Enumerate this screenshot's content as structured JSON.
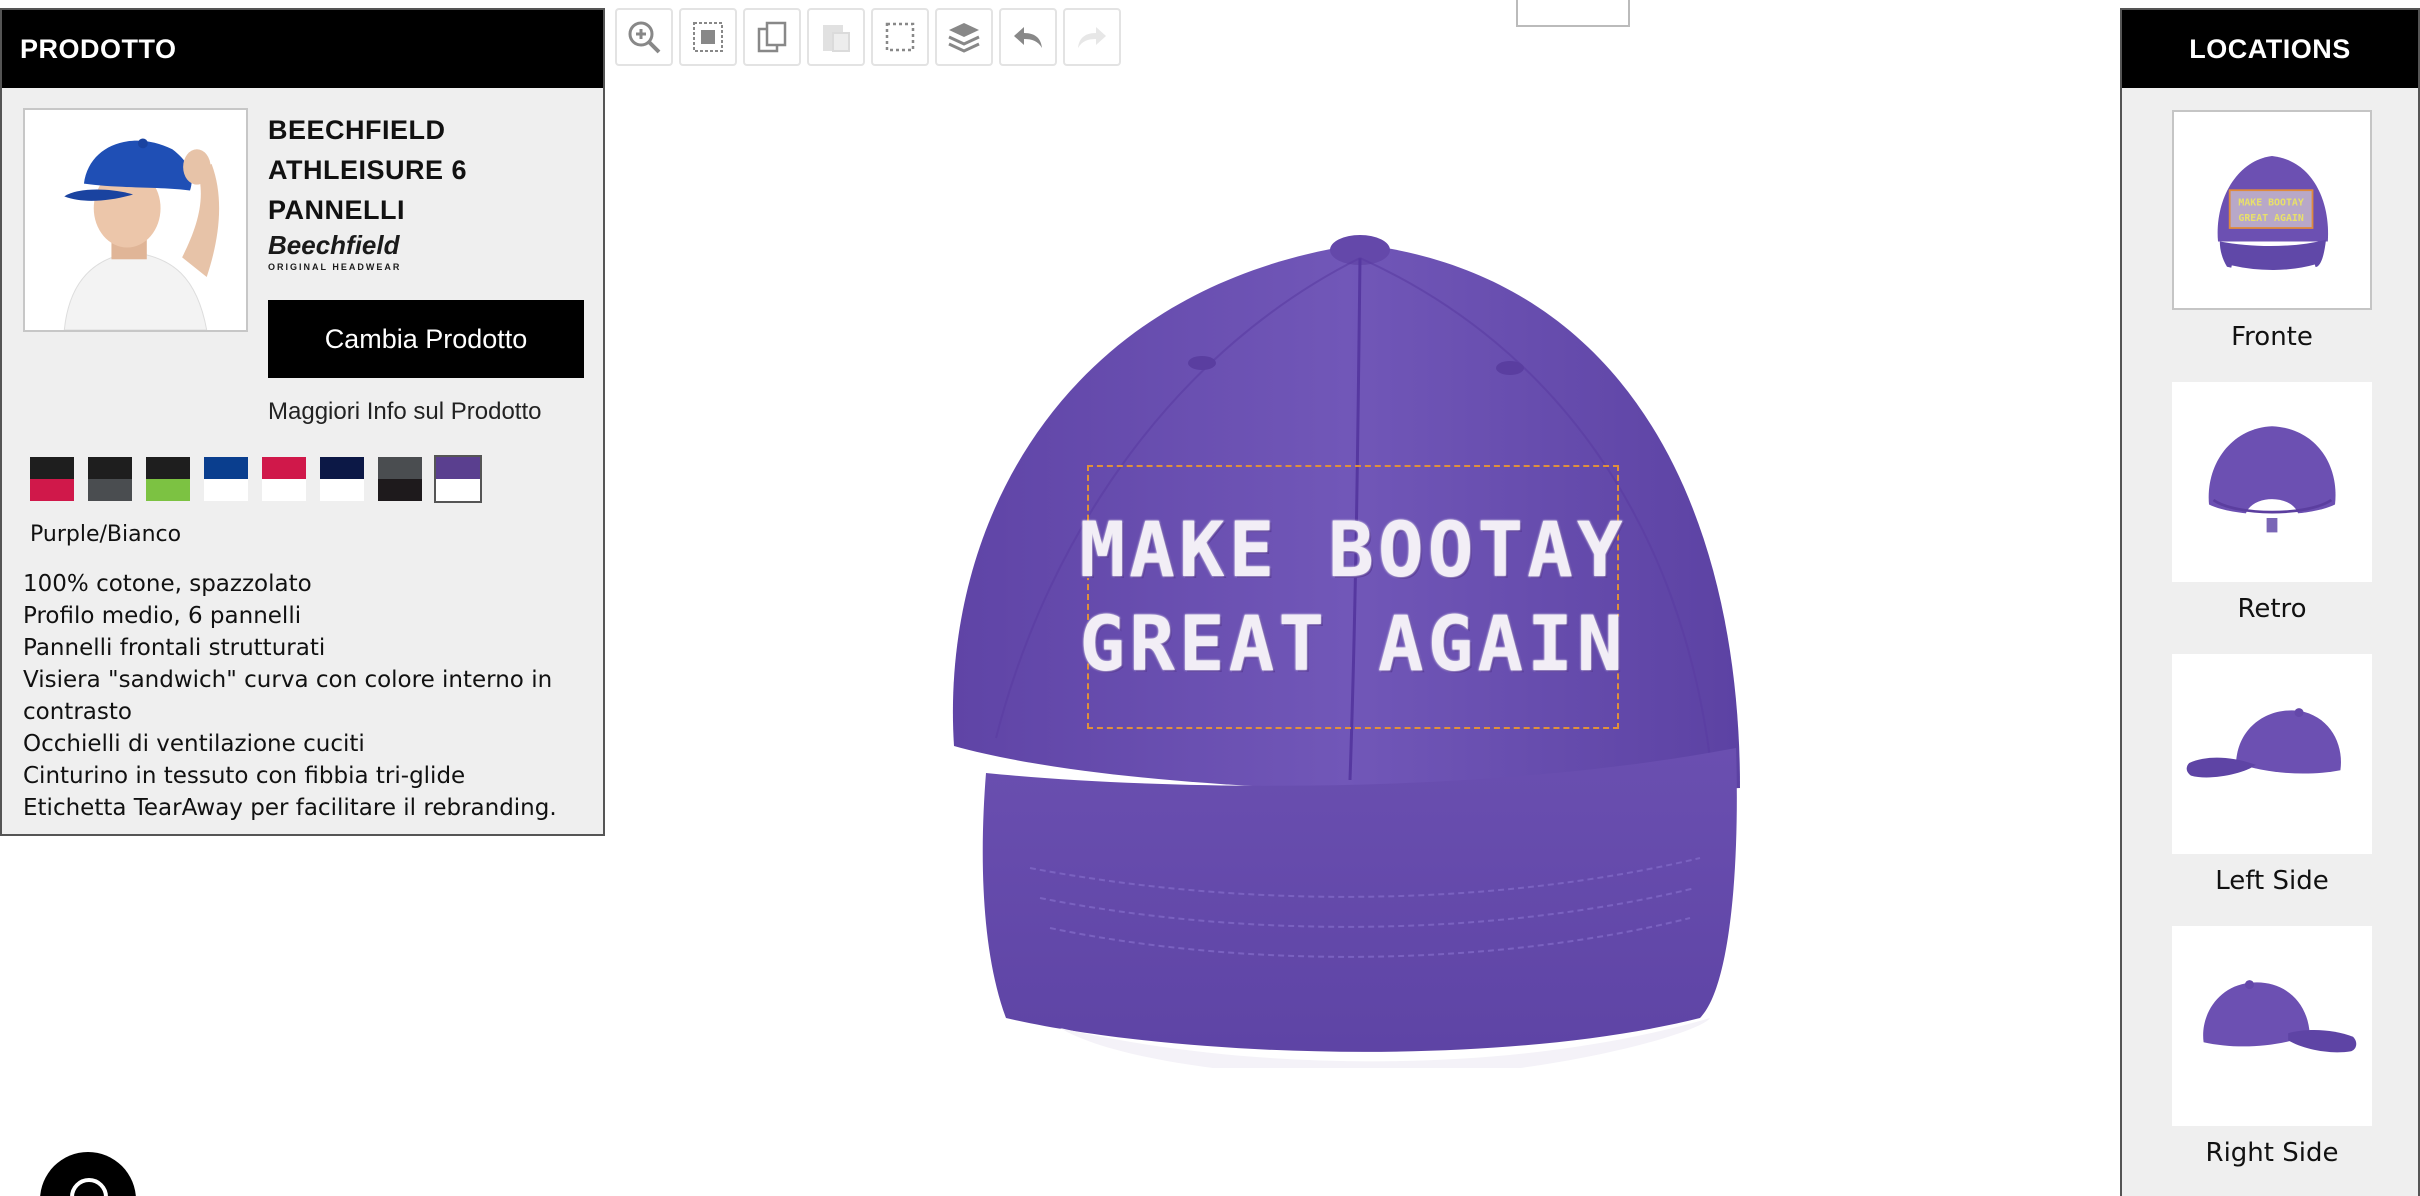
{
  "left_panel": {
    "header": "PRODOTTO",
    "product_name": "BEECHFIELD ATHLEISURE 6 PANNELLI",
    "brand_logo": "Beechfield",
    "brand_tagline": "ORIGINAL HEADWEAR",
    "change_button": "Cambia Prodotto",
    "more_info": "Maggiori Info sul Prodotto",
    "swatches": [
      {
        "top": "#1e1e1e",
        "bottom": "#d0184a"
      },
      {
        "top": "#1e1e1e",
        "bottom": "#4a4d50"
      },
      {
        "top": "#1e1e1e",
        "bottom": "#7cc242"
      },
      {
        "top": "#0a3e8e",
        "bottom": "#ffffff"
      },
      {
        "top": "#d0184a",
        "bottom": "#ffffff"
      },
      {
        "top": "#0c1846",
        "bottom": "#ffffff"
      },
      {
        "top": "#4a4d50",
        "bottom": "#1e1a1c"
      },
      {
        "top": "#5a3f8f",
        "bottom": "#ffffff"
      }
    ],
    "selected_color": "Purple/Bianco",
    "features": [
      "100% cotone, spazzolato",
      "Profilo medio, 6 pannelli",
      "Pannelli frontali strutturati",
      "Visiera \"sandwich\" curva con colore interno in contrasto",
      "Occhielli di ventilazione cuciti",
      "Cinturino in tessuto con fibbia tri-glide",
      "Etichetta TearAway per facilitare il rebranding."
    ]
  },
  "toolbar": {
    "tools": [
      "zoom-icon",
      "align-center-icon",
      "copy-icon",
      "paste-icon",
      "select-area-icon",
      "layers-icon",
      "undo-icon",
      "redo-icon"
    ]
  },
  "design": {
    "line1": "MAKE BOOTAY",
    "line2": "GREAT AGAIN"
  },
  "right_panel": {
    "header": "LOCATIONS",
    "locations": [
      {
        "label": "Fronte"
      },
      {
        "label": "Retro"
      },
      {
        "label": "Left Side"
      },
      {
        "label": "Right Side"
      }
    ]
  },
  "colors": {
    "cap_purple": "#6e52b4",
    "selection_border": "#e0903a"
  }
}
